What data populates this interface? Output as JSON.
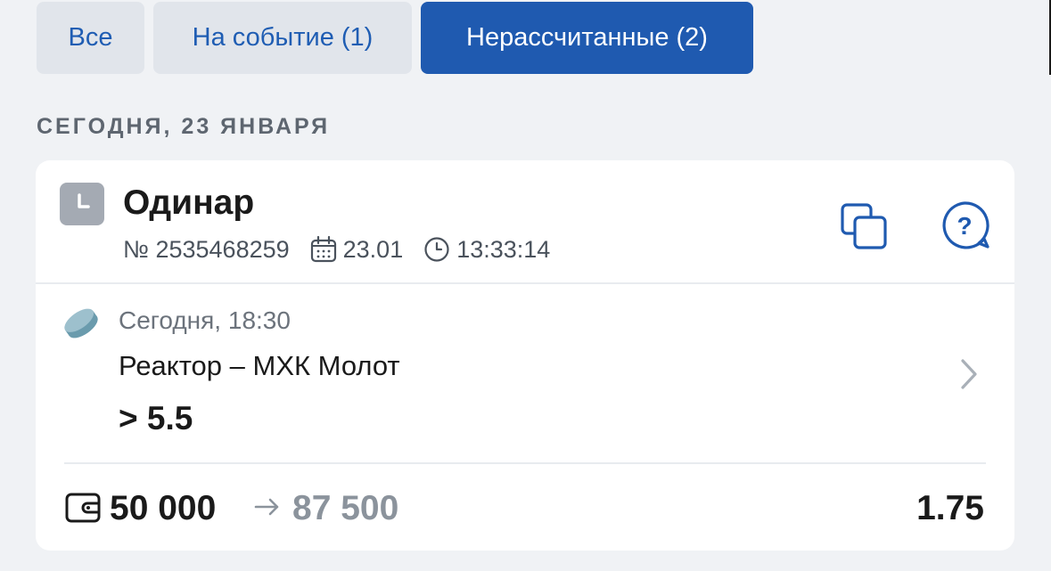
{
  "tabs": [
    {
      "label": "Все"
    },
    {
      "label": "На событие (1)"
    },
    {
      "label": "Нерассчитанные (2)"
    }
  ],
  "active_tab": "Нерассчитанные (2)",
  "section_title": "СЕГОДНЯ, 23 ЯНВАРЯ",
  "bet": {
    "type": "Одинар",
    "number": "№ 2535468259",
    "date": "23.01",
    "time": "13:33:14",
    "status_icon": "clock-icon",
    "event": {
      "sport_icon": "hockey-puck-icon",
      "time": "Сегодня, 18:30",
      "teams": "Реактор – МХК Молот",
      "outcome": "> 5.5"
    },
    "stake": "50 000",
    "payout": "87 500",
    "odds": "1.75"
  },
  "colors": {
    "accent": "#1f5ab0",
    "background": "#f0f2f5",
    "card": "#ffffff",
    "muted_text": "#6c737c"
  }
}
